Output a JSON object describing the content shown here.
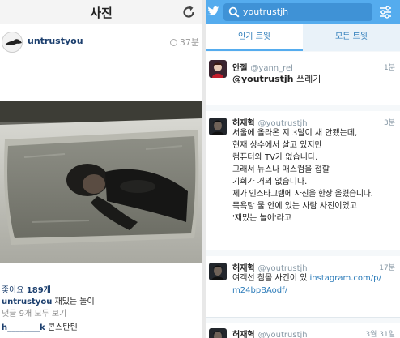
{
  "instagram": {
    "title": "사진",
    "username": "untrustyou",
    "time": "37분",
    "likes_label": "좋아요",
    "likes_count": "189개",
    "caption_user": "untrustyou",
    "caption_text": "재밌는 놀이",
    "view_comments": "댓글 9개 모두 보기",
    "comment_user": "h________k",
    "comment_text": "콘스탄틴"
  },
  "twitter": {
    "search_text": "youtrustjh",
    "tabs": [
      "인기 트윗",
      "모든 트윗"
    ],
    "tweets": [
      {
        "name": "안젤",
        "handle": "@yann_rel",
        "time": "1분",
        "mention": "@youtrustjh",
        "lines": [
          "쓰레기"
        ]
      },
      {
        "name": "허재혁",
        "handle": "@youtrustjh",
        "time": "3분",
        "lines": [
          "서울에 올라온 지 3달이 채 안됐는데,",
          "현재 상수에서 살고 있지만",
          "컴퓨터와 TV가 없습니다.",
          "그래서 뉴스나 매스컴을 접할",
          "기회가 거의 없습니다.",
          "제가 인스타그램에 사진을 한장 올렸습니다.",
          "목욕탕 물 안에 있는 사람 사진이었고",
          "'재밌는 놀이'라고"
        ]
      },
      {
        "name": "허재혁",
        "handle": "@youtrustjh",
        "time": "17분",
        "text_prefix": "여객선 침몰 사건이 있",
        "link_part1": "instagram.com/p/",
        "link_part2": "m24bpBAodf/"
      },
      {
        "name": "허재혁",
        "handle": "@youtrustjh",
        "time": "3월 31일"
      }
    ]
  },
  "colors": {
    "twitter_blue": "#55acee",
    "link_blue": "#2b7bb9",
    "instagram_user": "#1c3f6e"
  }
}
